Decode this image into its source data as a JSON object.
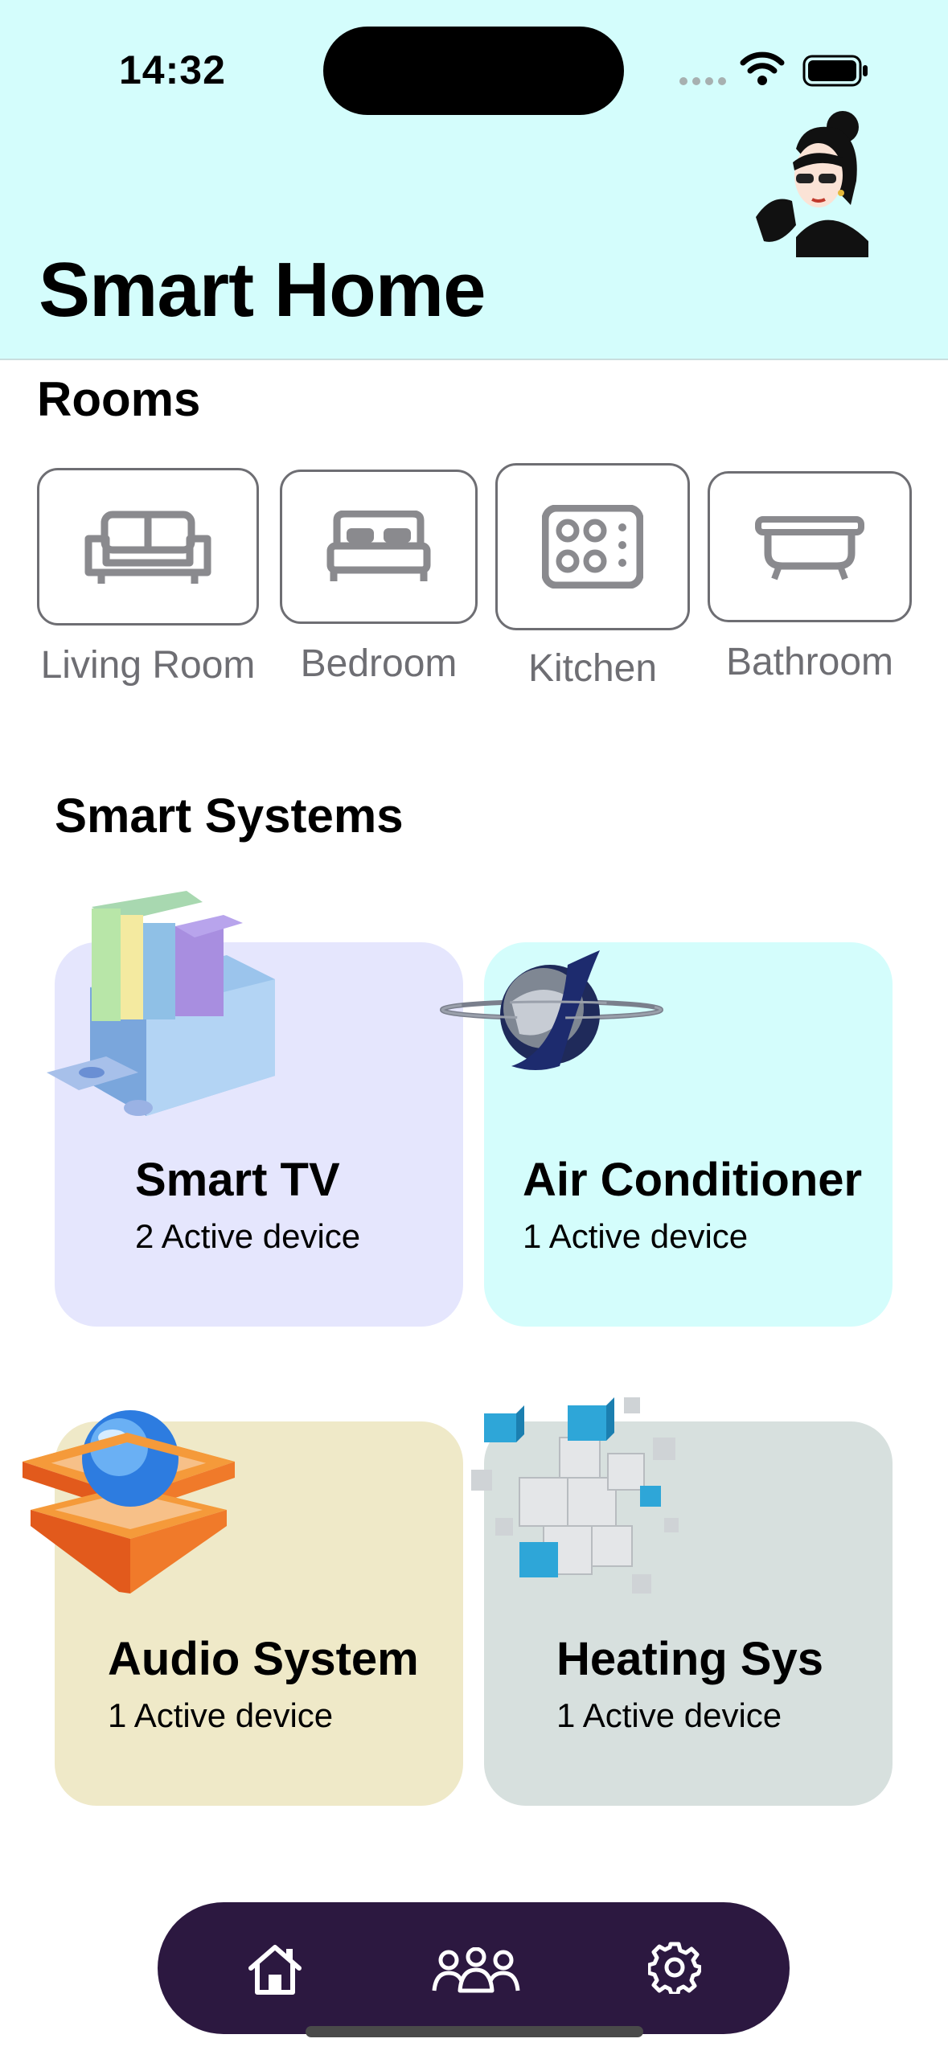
{
  "status_bar": {
    "time": "14:32"
  },
  "header": {
    "title": "Smart Home"
  },
  "rooms": {
    "title": "Rooms",
    "items": [
      {
        "label": "Living Room",
        "icon": "sofa-icon"
      },
      {
        "label": "Bedroom",
        "icon": "bed-icon"
      },
      {
        "label": "Kitchen",
        "icon": "stove-icon"
      },
      {
        "label": "Bathroom",
        "icon": "bathtub-icon"
      }
    ]
  },
  "systems": {
    "title": "Smart Systems",
    "cards": [
      {
        "name": "Smart TV",
        "subtitle": "2 Active device",
        "color": "#e5e6fd"
      },
      {
        "name": "Air Conditioner",
        "subtitle": "1 Active device",
        "color": "#d4fdfc"
      },
      {
        "name": "Audio System",
        "subtitle": "1 Active device",
        "color": "#efe9c8"
      },
      {
        "name": "Heating Sys",
        "subtitle": "1 Active device",
        "color": "#d7e0de"
      }
    ]
  },
  "nav": {
    "items": [
      {
        "icon": "home-icon"
      },
      {
        "icon": "people-icon"
      },
      {
        "icon": "gear-icon"
      }
    ],
    "color": "#2c1840"
  },
  "colors": {
    "header_bg": "#d4fdfc",
    "room_border": "#6e6e73"
  }
}
